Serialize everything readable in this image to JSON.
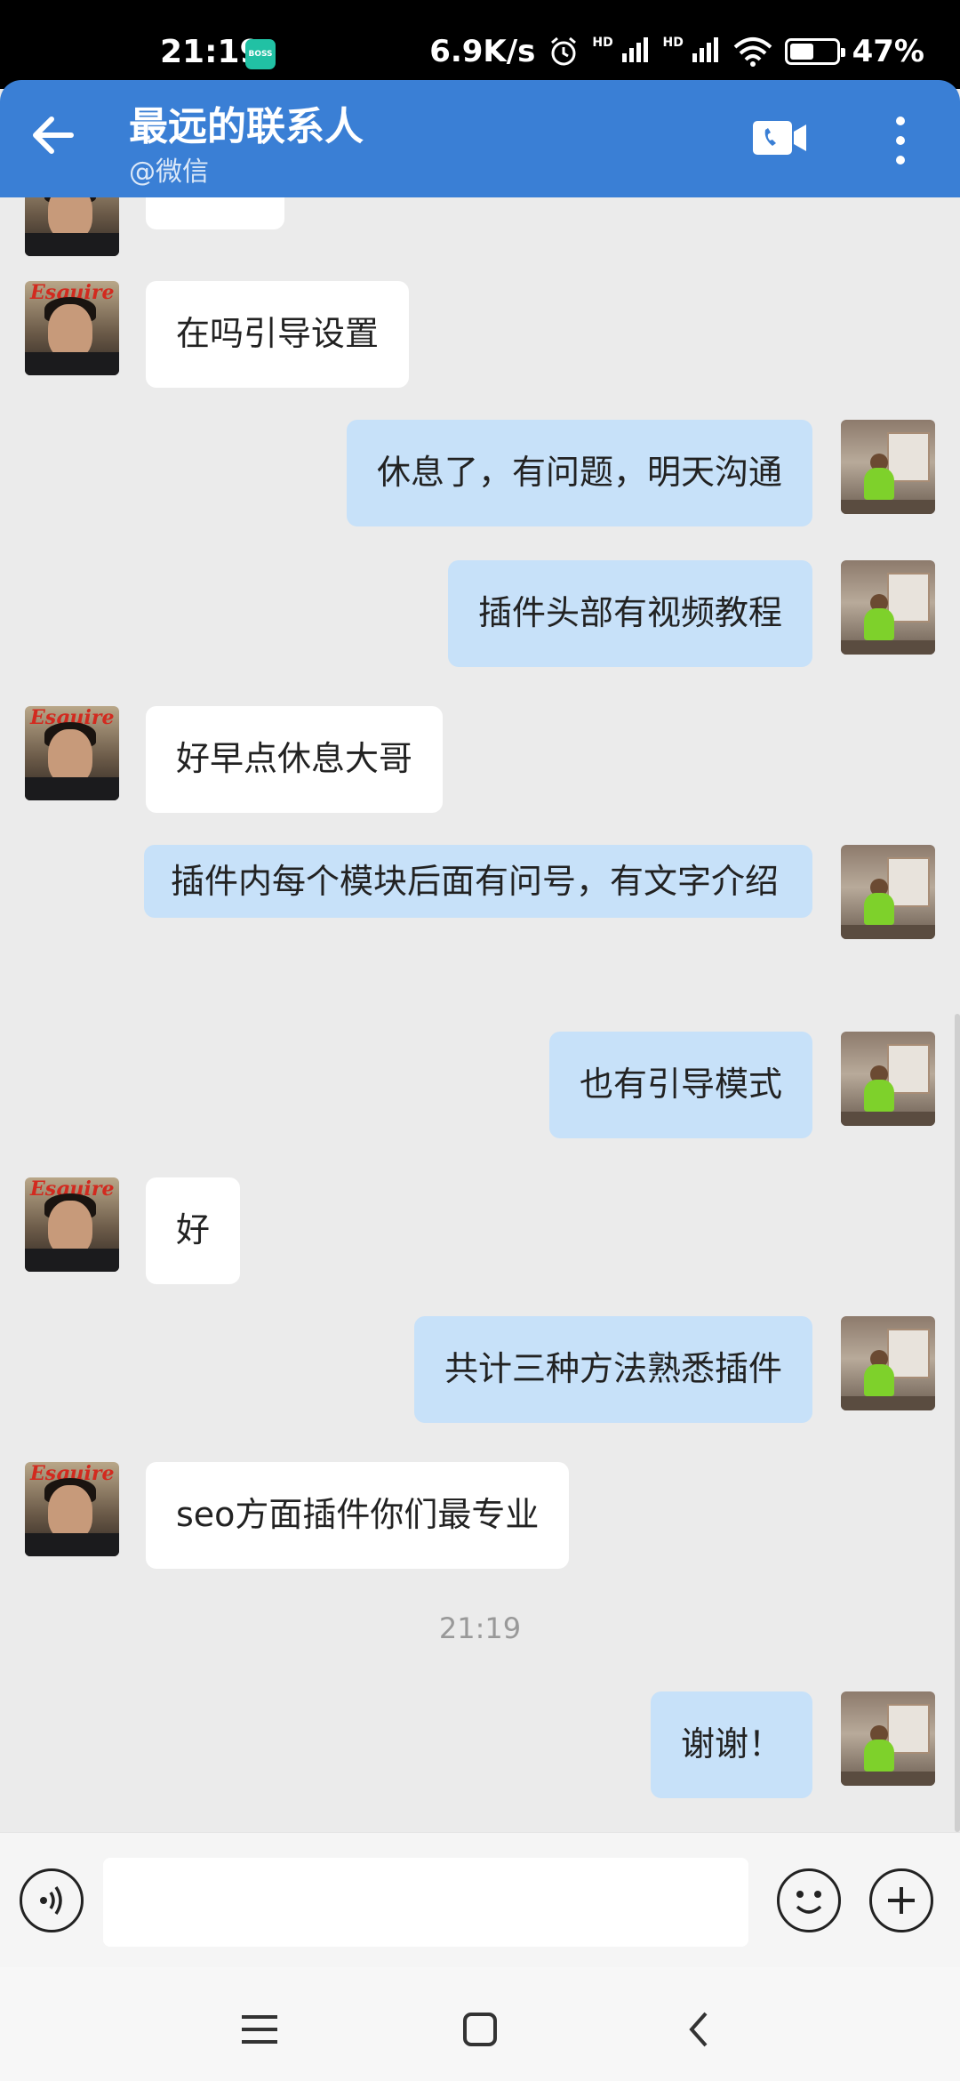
{
  "status_bar": {
    "time": "21:19",
    "boss_badge": "BOSS",
    "speed": "6.9K/s",
    "signal1": "HD",
    "signal2": "HD",
    "battery": "47%"
  },
  "header": {
    "title": "最远的联系人",
    "subtitle": "@微信"
  },
  "messages": [
    {
      "side": "left",
      "text": "在吗引导设置"
    },
    {
      "side": "right",
      "text": "休息了，有问题，明天沟通"
    },
    {
      "side": "right",
      "text": "插件头部有视频教程"
    },
    {
      "side": "left",
      "text": "好早点休息大哥"
    },
    {
      "side": "right",
      "text": "插件内每个模块后面有问号，有文字介绍"
    },
    {
      "side": "right",
      "text": "也有引导模式"
    },
    {
      "side": "left",
      "text": "好"
    },
    {
      "side": "right",
      "text": "共计三种方法熟悉插件"
    },
    {
      "side": "left",
      "text": "seo方面插件你们最专业"
    },
    {
      "side": "timestamp",
      "text": "21:19"
    },
    {
      "side": "right",
      "text": "谢谢！"
    }
  ],
  "avatar_left_text": "Esquire",
  "colors": {
    "header_bg": "#3a7fd5",
    "bubble_right": "#c7e1f9",
    "bubble_left": "#ffffff",
    "chat_bg": "#ebebeb"
  },
  "icons": {
    "back": "arrow-left-icon",
    "video_call": "video-call-icon",
    "more": "more-vertical-icon",
    "voice": "voice-icon",
    "emoji": "emoji-icon",
    "plus": "plus-icon",
    "nav_menu": "menu-icon",
    "nav_home": "home-icon",
    "nav_back": "chevron-left-icon"
  }
}
